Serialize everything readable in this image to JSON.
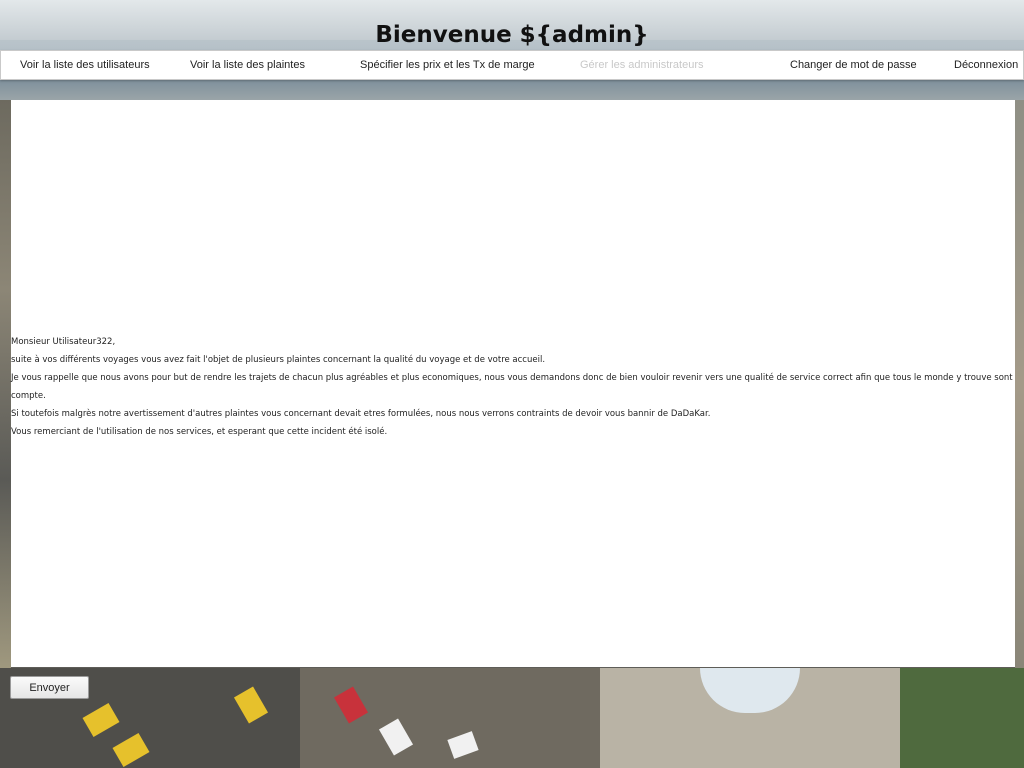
{
  "header": {
    "title": "Bienvenue ${admin}"
  },
  "nav": {
    "items": [
      {
        "label": "Voir la liste des utilisateurs",
        "enabled": true
      },
      {
        "label": "Voir la liste des plaintes",
        "enabled": true
      },
      {
        "label": "Spécifier les prix et les Tx de marge",
        "enabled": true
      },
      {
        "label": "Gérer les administrateurs",
        "enabled": false
      },
      {
        "label": "Changer de mot de passe",
        "enabled": true
      },
      {
        "label": "Déconnexion",
        "enabled": true
      }
    ]
  },
  "message": {
    "lines": [
      "Monsieur Utilisateur322,",
      "suite à vos différents voyages vous avez fait l'objet de plusieurs plaintes concernant la qualité du voyage et de votre accueil.",
      "Je vous rappelle que nous avons pour but de rendre les trajets de chacun plus agréables et plus economiques, nous vous demandons donc de bien vouloir revenir vers une qualité de service correct afin que tous le monde y trouve sont compte.",
      "Si toutefois malgrès notre avertissement d'autres plaintes vous concernant devait etres formulées, nous nous verrons contraints de devoir vous bannir de DaDaKar.",
      "Vous remerciant de l'utilisation de nos services, et esperant que cette incident été isolé."
    ]
  },
  "actions": {
    "send_label": "Envoyer"
  },
  "colors": {
    "disabled_text": "#c8c8c8",
    "panel_background": "#ffffff"
  }
}
